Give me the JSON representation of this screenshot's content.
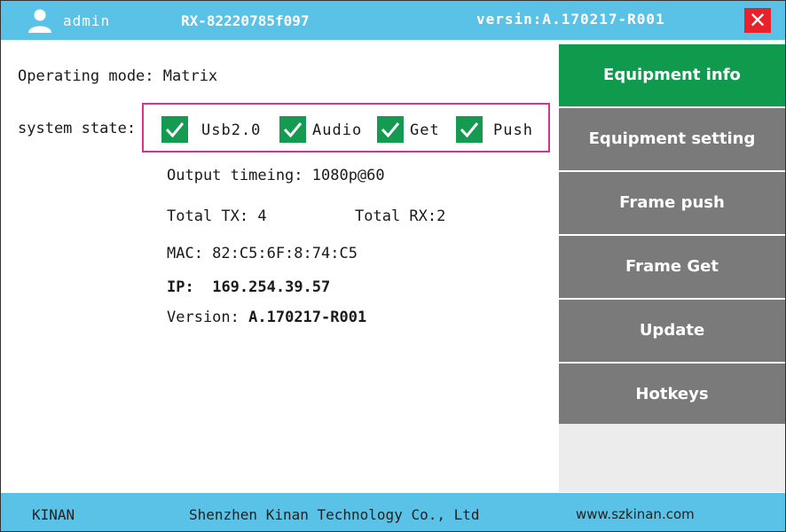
{
  "header": {
    "user": "admin",
    "device_id": "RX-82220785f097",
    "version": "versin:A.170217-R001",
    "close_label": "✕"
  },
  "status": {
    "operating_mode": "Operating mode: Matrix",
    "system_state_label": "system state:",
    "flags": [
      {
        "label": "Usb2.0",
        "checked": true
      },
      {
        "label": "Audio",
        "checked": true
      },
      {
        "label": "Get",
        "checked": true
      },
      {
        "label": "Push",
        "checked": true
      }
    ],
    "output_timing": "Output timeing: 1080p@60",
    "total_tx": "Total TX: 4",
    "total_rx": "Total RX:2",
    "mac": "MAC: 82:C5:6F:8:74:C5",
    "ip_label": "IP:",
    "ip_value": "169.254.39.57",
    "version_label": "Version:",
    "version_value": "A.170217-R001"
  },
  "menu": {
    "items": [
      {
        "label": "Equipment info",
        "active": true
      },
      {
        "label": "Equipment setting"
      },
      {
        "label": "Frame push"
      },
      {
        "label": "Frame Get"
      },
      {
        "label": "Update"
      },
      {
        "label": "Hotkeys"
      }
    ]
  },
  "footer": {
    "brand": "KINAN",
    "company": "Shenzhen Kinan Technology Co., Ltd",
    "website": "www.szkinan.com"
  },
  "colors": {
    "header_bg": "#5bc2e7",
    "active_menu": "#0f9a4e",
    "menu": "#7a7a7a",
    "check": "#159a52",
    "highlight_border": "#d3348a",
    "close": "#e8222a"
  }
}
